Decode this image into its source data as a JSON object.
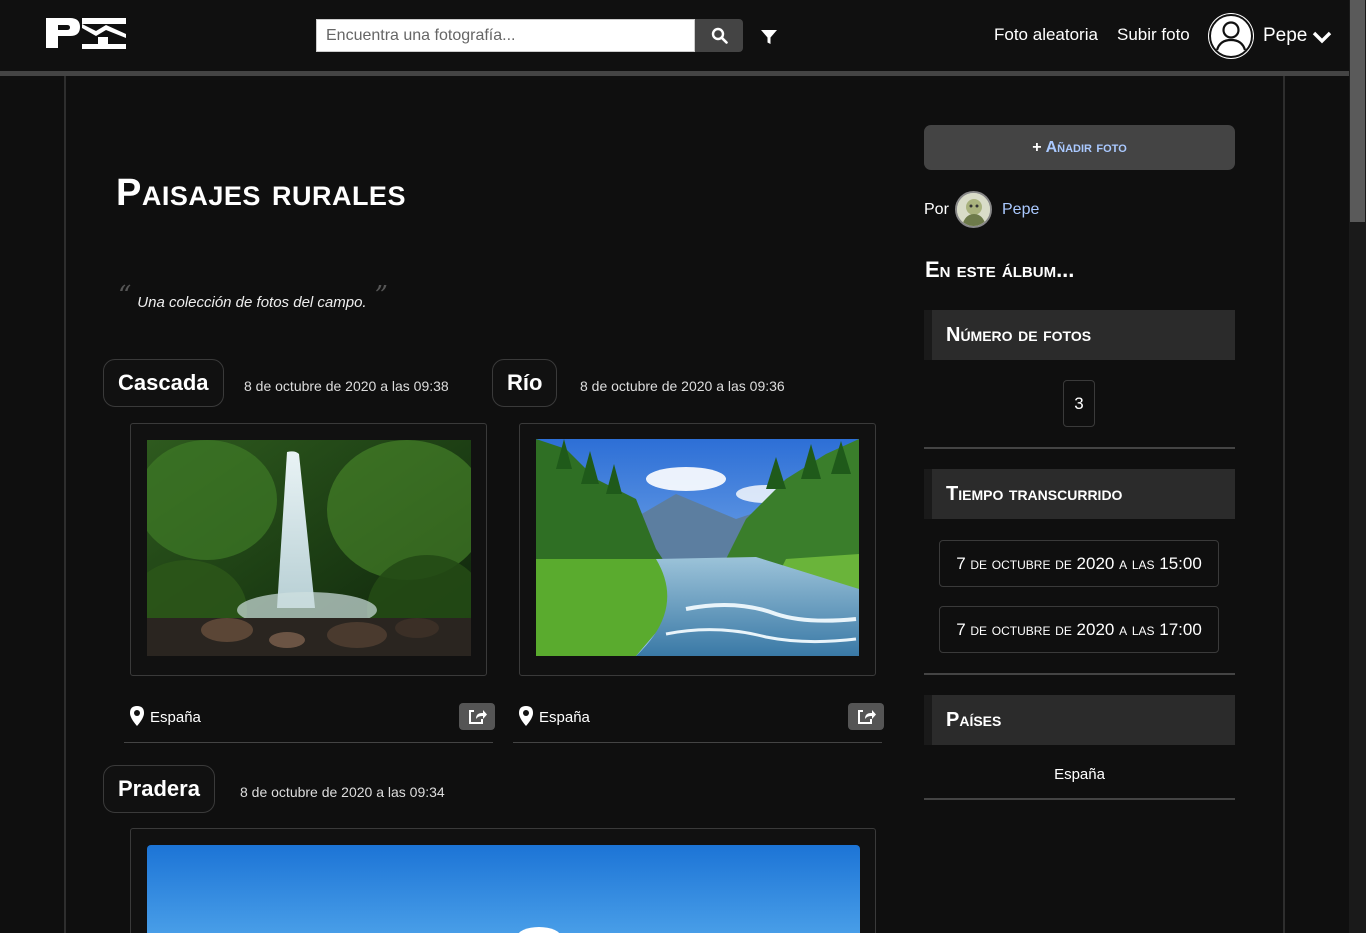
{
  "header": {
    "logo_text": "PI",
    "search_placeholder": "Encuentra una fotografía...",
    "nav": {
      "random_photo": "Foto aleatoria",
      "upload_photo": "Subir foto"
    },
    "user_name": "Pepe"
  },
  "album": {
    "title": "Paisajes rurales",
    "description": "Una colección de fotos del campo.",
    "quote_open": "“",
    "quote_close": "”"
  },
  "photos": [
    {
      "title": "Cascada",
      "date": "8 de octubre de 2020 a las 09:38",
      "location": "España",
      "image": "waterfall-forest"
    },
    {
      "title": "Río",
      "date": "8 de octubre de 2020 a las 09:36",
      "location": "España",
      "image": "river-mountains"
    },
    {
      "title": "Pradera",
      "date": "8 de octubre de 2020 a las 09:34",
      "location": "",
      "image": "meadow-sky"
    }
  ],
  "sidebar": {
    "add_photo_plus": "+",
    "add_photo_label": "Añadir foto",
    "by_label": "Por",
    "author": "Pepe",
    "in_album_title": "En este álbum...",
    "photo_count_title": "Número de fotos",
    "photo_count": "3",
    "time_title": "Tiempo transcurrido",
    "time_start": "7 de octubre de 2020 a las 15:00",
    "time_end": "7 de octubre de 2020 a las 17:00",
    "countries_title": "Países",
    "countries": [
      "España"
    ]
  },
  "colors": {
    "accent_link": "#aac9ff",
    "background": "#0f0f0f",
    "panel": "#2b2b2b"
  }
}
